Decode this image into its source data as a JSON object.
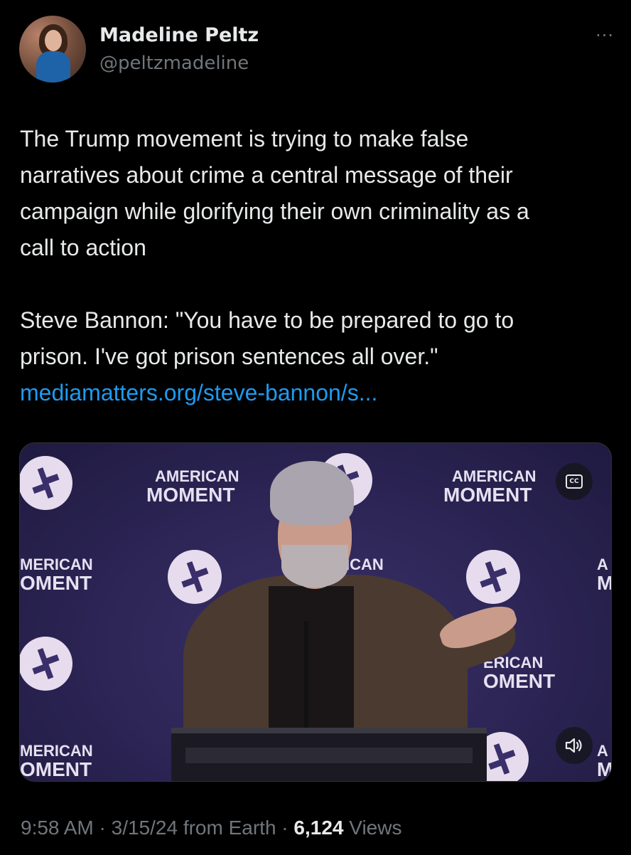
{
  "author": {
    "name": "Madeline Peltz",
    "handle": "@peltzmadeline",
    "avatar_icon": "profile-photo"
  },
  "more_icon": "ellipsis-icon",
  "more_glyph": "···",
  "tweet": {
    "paragraph1_lines": [
      "The Trump movement is trying to make false",
      "narratives about crime a central message of their",
      "campaign while glorifying their own criminality as a",
      "call to action"
    ],
    "paragraph2_lines": [
      "Steve Bannon: \"You have to be prepared to go to",
      "prison. I've got prison sentences all over.\""
    ],
    "link_text": "mediamatters.org/steve-bannon/s..."
  },
  "video": {
    "backdrop_brand_line1": "AMERICAN",
    "backdrop_brand_line2": "MOMENT",
    "partial_brand_line1_left": "MERICAN",
    "partial_brand_line2_left": "OMENT",
    "partial_brand_line1_mid": "ERICAN",
    "partial_brand_line2_mid": "OMENT",
    "partial_mid_upper": "ICAN",
    "partial_right_a": "A",
    "partial_right_m": "M",
    "cc_label": "CC",
    "captions_icon": "captions-icon",
    "volume_icon": "speaker-icon"
  },
  "meta": {
    "time": "9:58 AM",
    "date": "3/15/24",
    "source": "from Earth",
    "separator": " · ",
    "views_count": "6,124",
    "views_label": "Views"
  },
  "colors": {
    "background": "#000000",
    "text": "#e7e9ea",
    "secondary": "#71767b",
    "link": "#1d9bf0"
  }
}
